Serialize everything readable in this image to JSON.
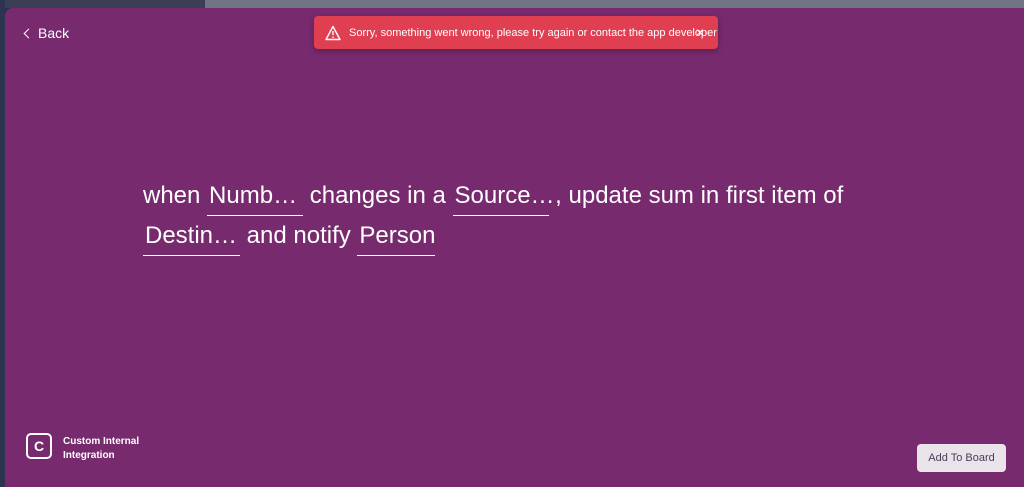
{
  "back": {
    "label": "Back"
  },
  "toast": {
    "message": "Sorry, something went wrong, please try again or contact the app developer",
    "close_glyph": "×",
    "color": "#df3f50"
  },
  "recipe": {
    "w1": "when",
    "field1": "Numb…",
    "w2": "changes in a",
    "field2": "Source…",
    "w3": ", update sum in first item of",
    "field3": "Destin…",
    "w4": "and notify",
    "field4": "Person"
  },
  "integration": {
    "logo_letter": "C",
    "name": "Custom Internal Integration"
  },
  "actions": {
    "add_to_board": "Add To Board"
  },
  "colors": {
    "modal_bg": "#772a6d",
    "button_bg": "#e9e4ea"
  }
}
